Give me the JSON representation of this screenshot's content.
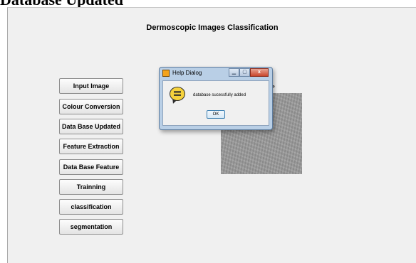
{
  "page": {
    "heading_fragment": "Database Updated"
  },
  "app": {
    "title": "Dermoscopic Images Classification"
  },
  "buttons": [
    {
      "label": "Input Image"
    },
    {
      "label": "Colour Conversion"
    },
    {
      "label": "Data Base Updated"
    },
    {
      "label": "Feature Extraction"
    },
    {
      "label": "Data Base Feature"
    },
    {
      "label": "Trainning"
    },
    {
      "label": "classification"
    },
    {
      "label": "segmentation"
    }
  ],
  "image_panel": {
    "caption_fragment": "ge"
  },
  "dialog": {
    "title": "Help Dialog",
    "message": "database sucessfully added",
    "ok_label": "OK",
    "icon": "help-speech-bubble-icon",
    "close_glyph": "x"
  },
  "colors": {
    "window_bg": "#f0f0f0",
    "dialog_frame": "#b9cfe6",
    "close_button": "#c9462c"
  }
}
